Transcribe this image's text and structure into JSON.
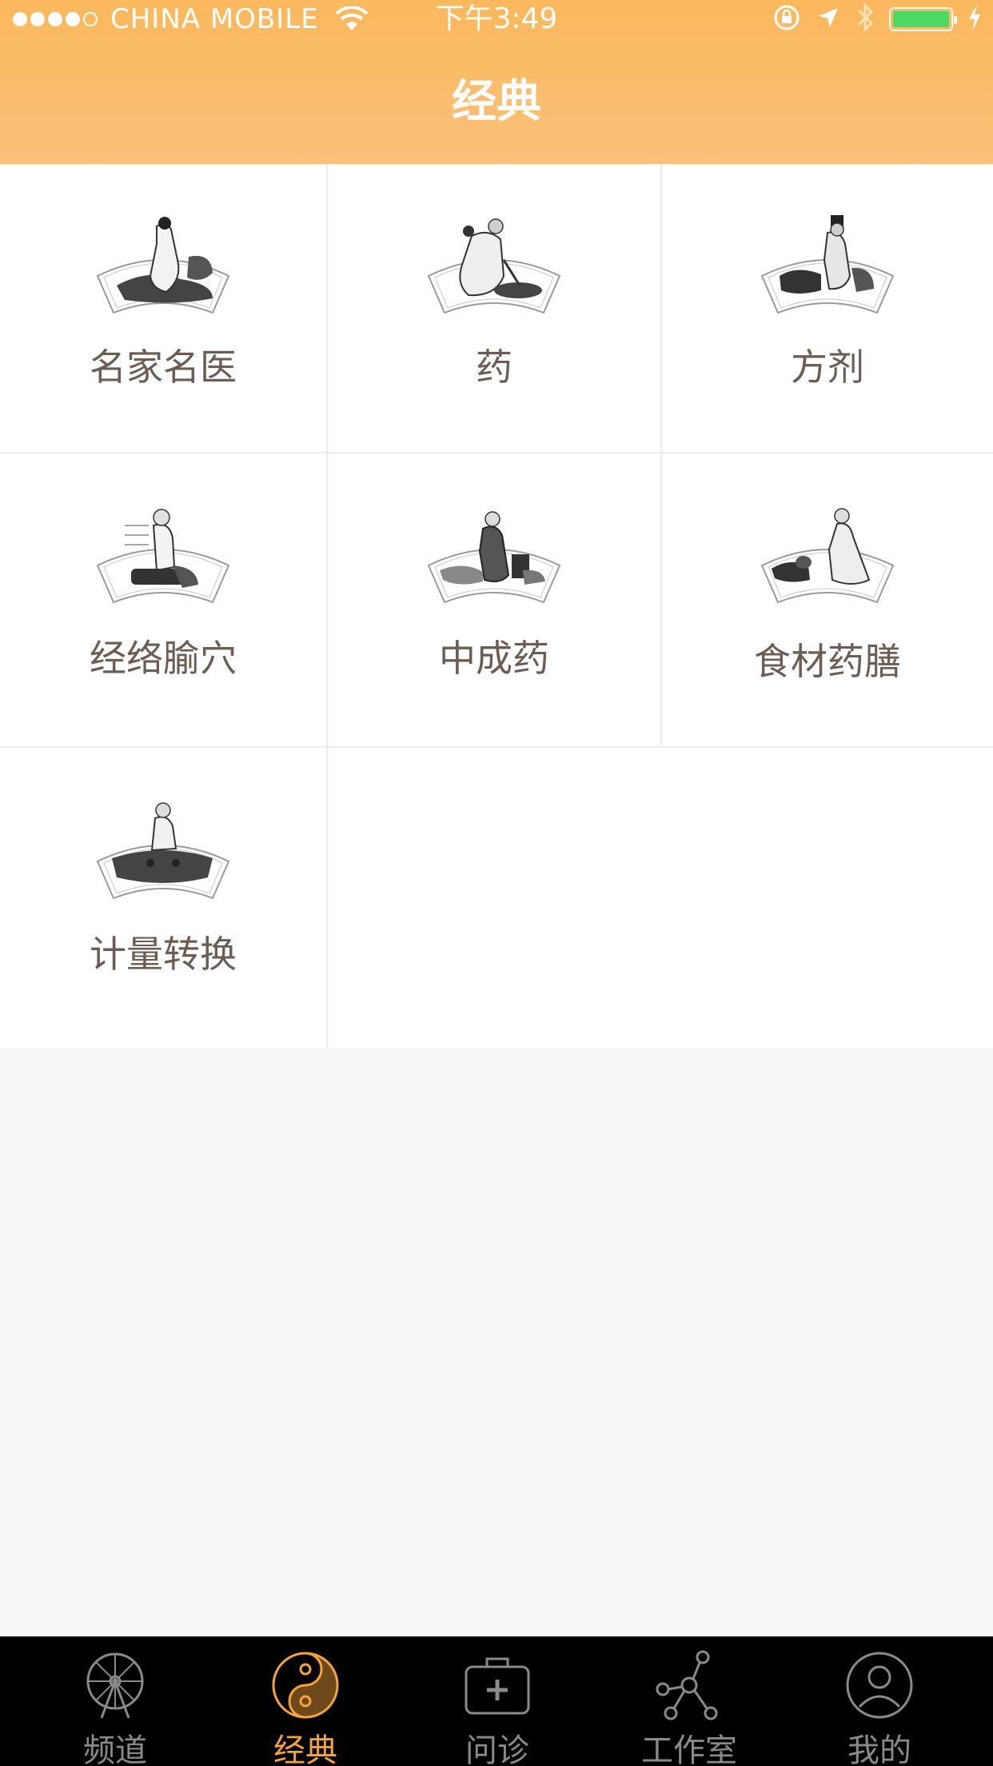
{
  "status_bar": {
    "carrier": "CHINA MOBILE",
    "time": "下午3:49",
    "battery_color": "#4cd964"
  },
  "nav": {
    "title": "经典",
    "gradient": [
      "#fbb85c",
      "#fbc17a"
    ]
  },
  "grid": {
    "items": [
      {
        "label": "名家名医",
        "icon": "sage-reading-fan-icon"
      },
      {
        "label": "药",
        "icon": "herbalist-fan-icon"
      },
      {
        "label": "方剂",
        "icon": "scholar-desk-fan-icon"
      },
      {
        "label": "经络腧穴",
        "icon": "acupuncture-figure-fan-icon"
      },
      {
        "label": "中成药",
        "icon": "medicine-maker-fan-icon"
      },
      {
        "label": "食材药膳",
        "icon": "reclining-scholar-fan-icon"
      },
      {
        "label": "计量转换",
        "icon": "measuring-scholar-fan-icon"
      }
    ]
  },
  "tabbar": {
    "active_color": "#f5a33a",
    "inactive_color": "#8a8a8a",
    "tabs": [
      {
        "label": "频道",
        "icon": "ferris-wheel-icon",
        "active": false
      },
      {
        "label": "经典",
        "icon": "yin-yang-icon",
        "active": true
      },
      {
        "label": "问诊",
        "icon": "medical-kit-icon",
        "active": false
      },
      {
        "label": "工作室",
        "icon": "network-icon",
        "active": false
      },
      {
        "label": "我的",
        "icon": "user-icon",
        "active": false
      }
    ]
  }
}
